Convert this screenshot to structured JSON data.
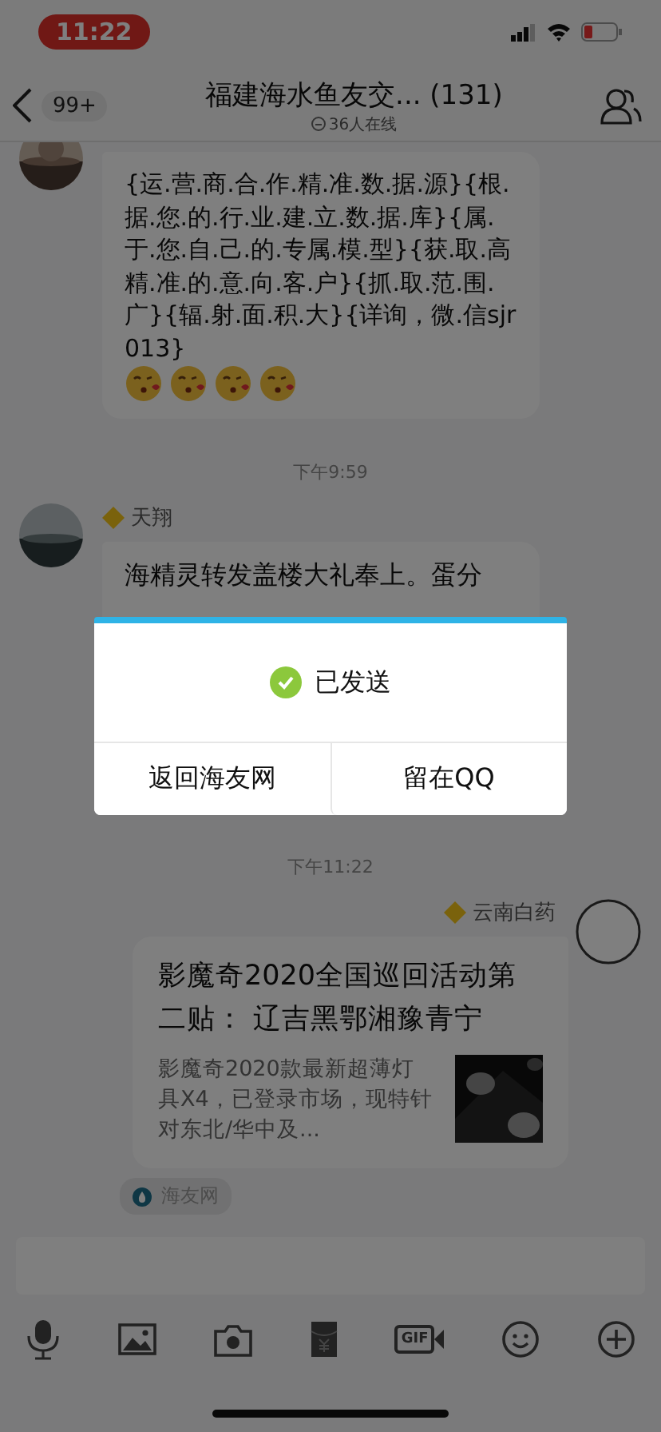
{
  "status_bar": {
    "time": "11:22"
  },
  "nav": {
    "back_badge": "99+",
    "title": "福建海水鱼友交... (131)",
    "online": "36人在线"
  },
  "messages": [
    {
      "kind": "text",
      "outgoing": false,
      "text": "{运.营.商.合.作.精.准.数.据.源}{根.据.您.的.行.业.建.立.数.据.库}{属.于.您.自.己.的.专属.模.型}{获.取.高精.准.的.意.向.客.户}{抓.取.范.围.广}{辐.射.面.积.大}{详询，微.信sjr013}",
      "emojis": [
        {
          "kind": "kiss"
        },
        {
          "kind": "kiss"
        },
        {
          "kind": "kiss"
        },
        {
          "kind": "kiss"
        }
      ]
    },
    {
      "kind": "time",
      "text": "下午9:59"
    },
    {
      "kind": "text",
      "outgoing": false,
      "sender": "天翔",
      "text": "海精灵转发盖楼大礼奉上。蛋分"
    },
    {
      "kind": "time",
      "text": "下午11:22"
    },
    {
      "kind": "card",
      "outgoing": true,
      "sender": "云南白药",
      "title": "影魔奇2020全国巡回活动第二贴： 辽吉黑鄂湘豫青宁",
      "summary": "影魔奇2020款最新超薄灯具X4，已登录市场，现特针对东北/华中及...",
      "source": "海友网"
    }
  ],
  "toolbar": {
    "gif_label": "GIF"
  },
  "dialog": {
    "status": "已发送",
    "buttons": [
      "返回海友网",
      "留在QQ"
    ]
  }
}
